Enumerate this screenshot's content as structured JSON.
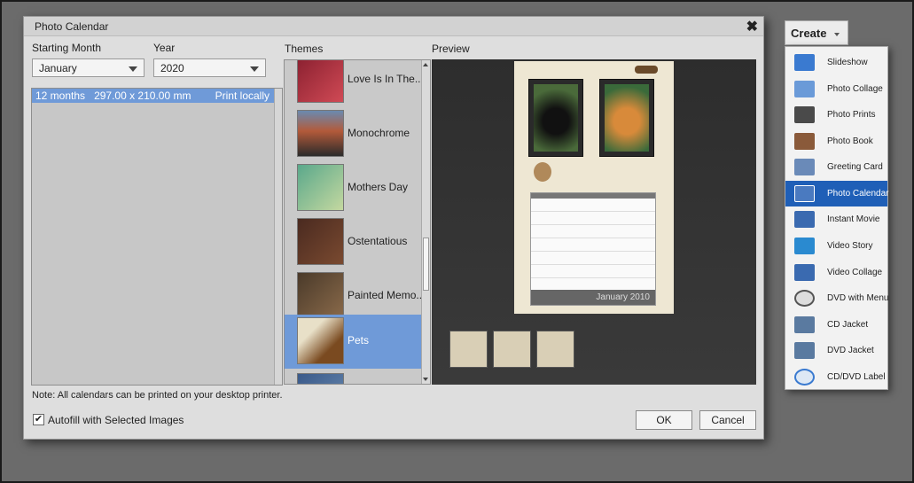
{
  "dialog": {
    "title": "Photo Calendar",
    "close_glyph": "✖",
    "starting_month_label": "Starting Month",
    "starting_month_value": "January",
    "year_label": "Year",
    "year_value": "2020",
    "themes_label": "Themes",
    "preview_label": "Preview",
    "size_row": {
      "months": "12 months",
      "size": "297.00 x 210.00 mm",
      "print": "Print locally"
    },
    "themes": [
      {
        "label": "Love Is In The...",
        "colors": [
          "#8a2030",
          "#d04a55"
        ]
      },
      {
        "label": "Monochrome",
        "colors": [
          "#2b2b2b",
          "#b35a3a"
        ]
      },
      {
        "label": "Mothers Day",
        "colors": [
          "#5aa88b",
          "#c4d8a0"
        ]
      },
      {
        "label": "Ostentatious",
        "colors": [
          "#4a2a20",
          "#7a4a30"
        ]
      },
      {
        "label": "Painted Memo...",
        "colors": [
          "#4a3a2a",
          "#8a6a4a"
        ]
      },
      {
        "label": "Pets",
        "colors": [
          "#7a4a20",
          "#e8e0c8"
        ],
        "selected": true
      },
      {
        "label": "",
        "colors": [
          "#3a5a8a",
          "#6a8ab0"
        ]
      }
    ],
    "calendar_month": "January 2010",
    "note": "Note: All calendars can be printed on your desktop printer.",
    "autofill_label": "Autofill with Selected Images",
    "autofill_checked": true,
    "ok_label": "OK",
    "cancel_label": "Cancel"
  },
  "create_menu": {
    "button_label": "Create",
    "items": [
      {
        "label": "Slideshow",
        "icon": "slideshow-icon",
        "color": "#3a7ad0"
      },
      {
        "label": "Photo Collage",
        "icon": "photo-collage-icon",
        "color": "#6a9ad8"
      },
      {
        "label": "Photo Prints",
        "icon": "printer-icon",
        "color": "#4a4a4a"
      },
      {
        "label": "Photo Book",
        "icon": "photo-book-icon",
        "color": "#8a5a3a"
      },
      {
        "label": "Greeting Card",
        "icon": "greeting-card-icon",
        "color": "#6a8ab8"
      },
      {
        "label": "Photo Calendar",
        "icon": "calendar-icon",
        "color": "#4a7ac0",
        "selected": true
      },
      {
        "label": "Instant Movie",
        "icon": "instant-movie-icon",
        "color": "#3a6ab0"
      },
      {
        "label": "Video Story",
        "icon": "video-story-icon",
        "color": "#2a8ad0"
      },
      {
        "label": "Video Collage",
        "icon": "video-collage-icon",
        "color": "#3a6ab0"
      },
      {
        "label": "DVD with Menu",
        "icon": "dvd-icon",
        "color": "#555555"
      },
      {
        "label": "CD Jacket",
        "icon": "cd-jacket-icon",
        "color": "#5a7aa0"
      },
      {
        "label": "DVD Jacket",
        "icon": "dvd-jacket-icon",
        "color": "#5a7aa0"
      },
      {
        "label": "CD/DVD Label",
        "icon": "disc-label-icon",
        "color": "#3a7ad0"
      }
    ]
  }
}
